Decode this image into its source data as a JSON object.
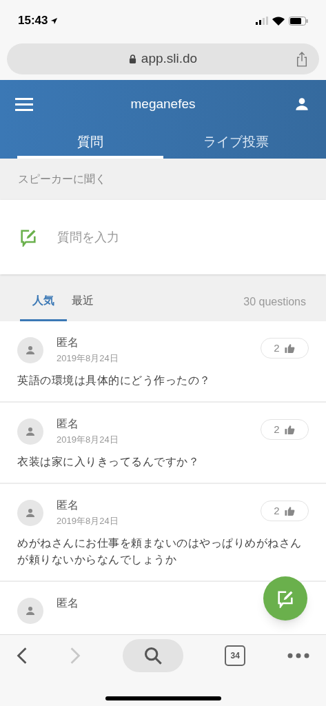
{
  "status_bar": {
    "time": "15:43"
  },
  "browser": {
    "url": "app.sli.do",
    "tab_count": "34",
    "back_disabled": false,
    "forward_disabled": true
  },
  "header": {
    "title": "meganefes"
  },
  "tabs": [
    {
      "label": "質問",
      "selected": true
    },
    {
      "label": "ライブ投票",
      "selected": false
    }
  ],
  "section_label": "スピーカーに聞く",
  "question_input": {
    "placeholder": "質問を入力"
  },
  "sort_tabs": [
    {
      "label": "人気",
      "selected": true
    },
    {
      "label": "最近",
      "selected": false
    }
  ],
  "question_count": "30 questions",
  "questions": [
    {
      "author": "匿名",
      "date": "2019年8月24日",
      "likes": "2",
      "text": "英語の環境は具体的にどう作ったの？"
    },
    {
      "author": "匿名",
      "date": "2019年8月24日",
      "likes": "2",
      "text": "衣装は家に入りきってるんですか？"
    },
    {
      "author": "匿名",
      "date": "2019年8月24日",
      "likes": "2",
      "text": "めがねさんにお仕事を頼まないのはやっぱりめがねさんが頼りないからなんでしょうか"
    },
    {
      "author": "匿名"
    }
  ]
}
